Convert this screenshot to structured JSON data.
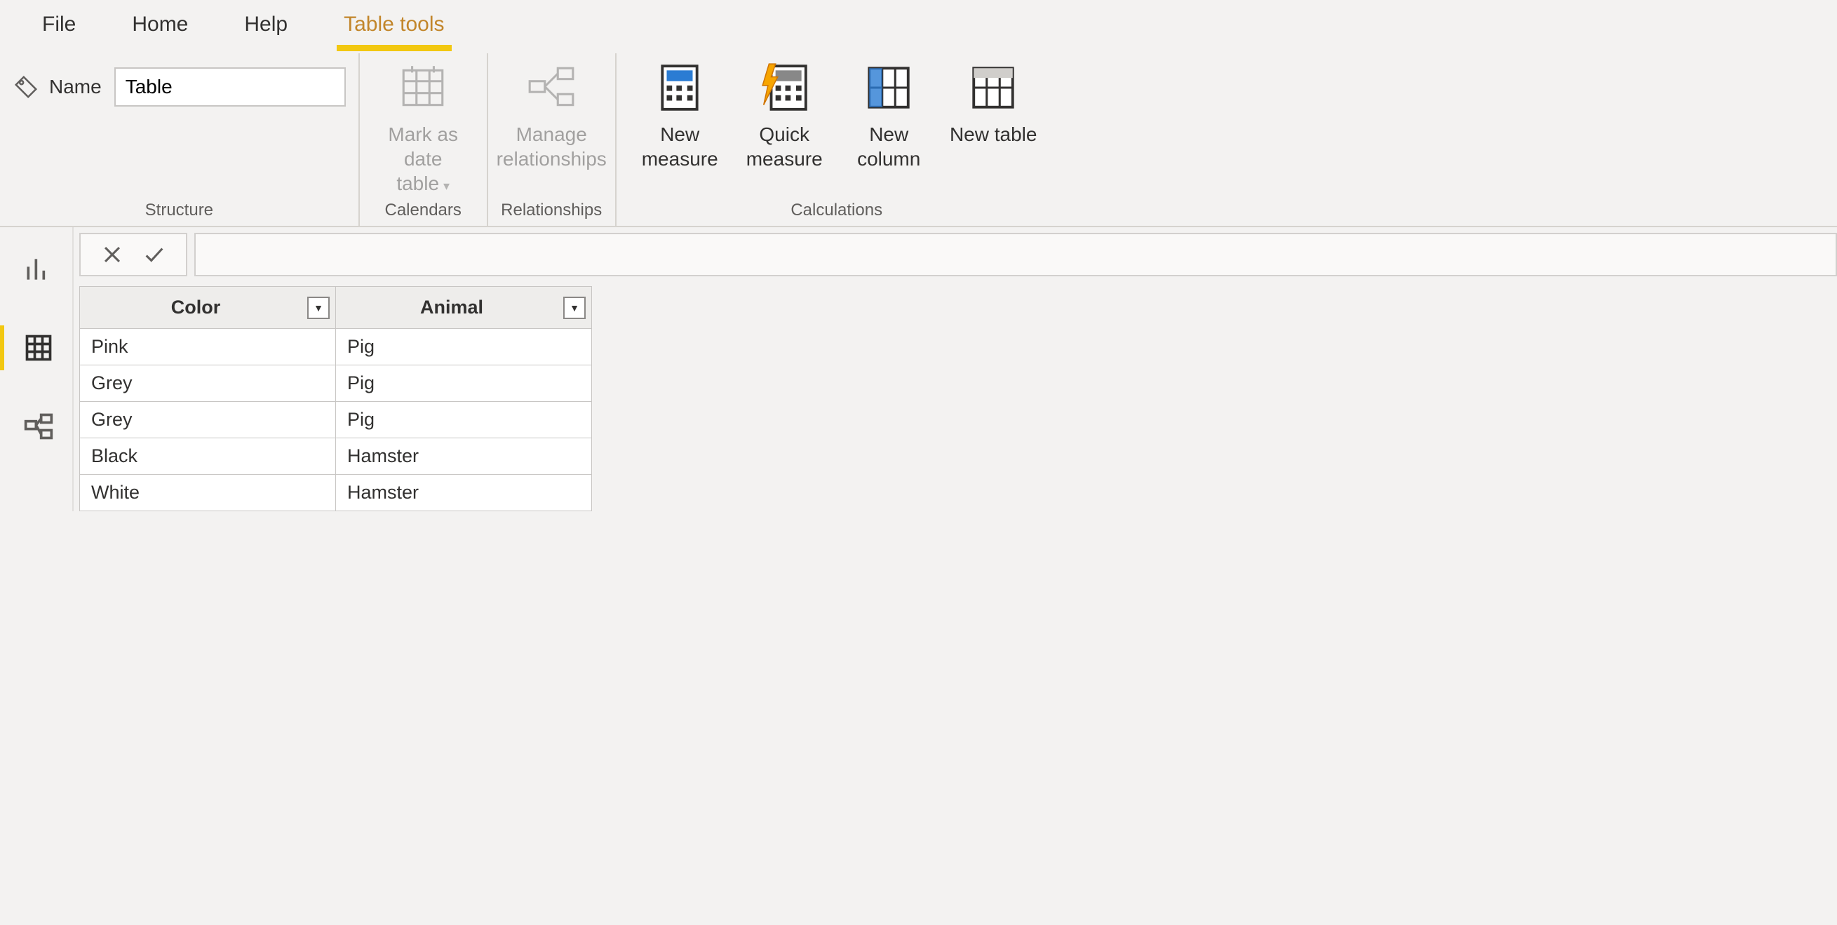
{
  "menu": {
    "items": [
      "File",
      "Home",
      "Help",
      "Table tools"
    ],
    "active": "Table tools"
  },
  "ribbon": {
    "structure": {
      "group_label": "Structure",
      "name_label": "Name",
      "name_value": "Table"
    },
    "calendars": {
      "group_label": "Calendars",
      "mark_date_label": "Mark as date table"
    },
    "relationships": {
      "group_label": "Relationships",
      "manage_label": "Manage relationships"
    },
    "calculations": {
      "group_label": "Calculations",
      "new_measure_label": "New measure",
      "quick_measure_label": "Quick measure",
      "new_column_label": "New column",
      "new_table_label": "New table"
    }
  },
  "table": {
    "columns": [
      "Color",
      "Animal"
    ],
    "rows": [
      [
        "Pink",
        "Pig"
      ],
      [
        "Grey",
        "Pig"
      ],
      [
        "Grey",
        "Pig"
      ],
      [
        "Black",
        "Hamster"
      ],
      [
        "White",
        "Hamster"
      ]
    ]
  }
}
